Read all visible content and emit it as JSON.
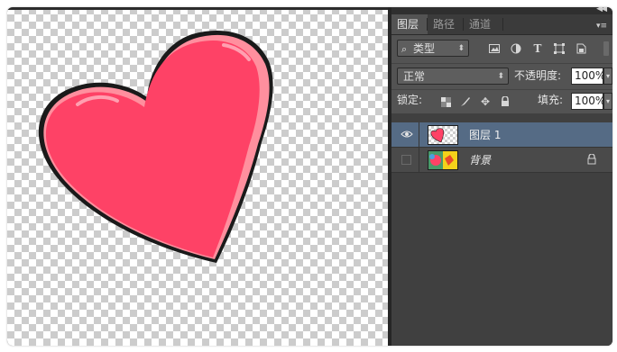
{
  "panel": {
    "tabs": [
      {
        "label": "图层",
        "active": true
      },
      {
        "label": "路径",
        "active": false
      },
      {
        "label": "通道",
        "active": false
      }
    ],
    "filter": {
      "selected": "类型",
      "icons": [
        "image-filter-icon",
        "adjustment-filter-icon",
        "type-filter-icon",
        "shape-filter-icon",
        "smart-object-filter-icon"
      ]
    },
    "blend": {
      "mode": "正常",
      "opacity_label": "不透明度:",
      "opacity_value": "100%"
    },
    "lock": {
      "label": "锁定:",
      "icons": [
        "lock-transparent-icon",
        "lock-image-icon",
        "lock-position-icon",
        "lock-all-icon"
      ],
      "fill_label": "填充:",
      "fill_value": "100%"
    },
    "layers": [
      {
        "name": "图层 1",
        "visible": true,
        "selected": true
      },
      {
        "name": "背景",
        "visible": false,
        "selected": false,
        "locked": true
      }
    ]
  },
  "canvas": {
    "heart_fill": "#fe4266",
    "heart_highlight": "#ff8f9e",
    "heart_outline": "#1a1a1a"
  },
  "colors": {
    "panel_bg": "#535353",
    "selected_layer": "#556b85"
  }
}
